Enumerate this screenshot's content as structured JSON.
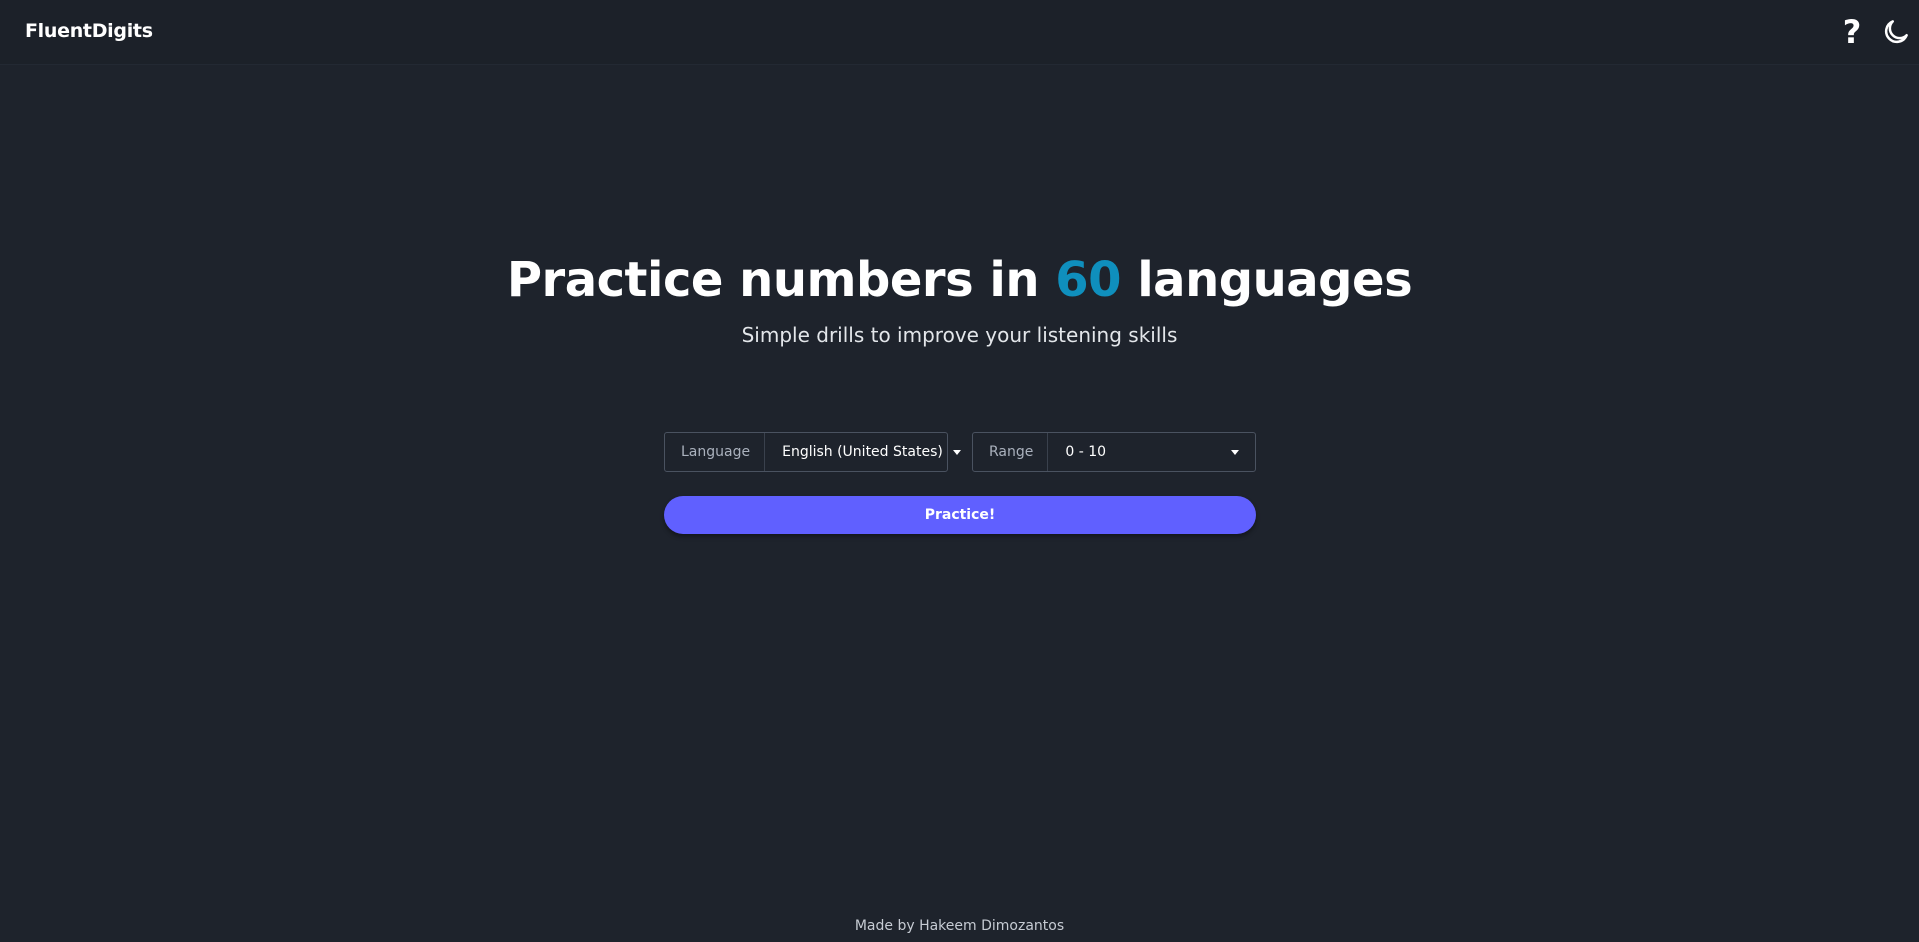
{
  "header": {
    "brand": "FluentDigits",
    "help_icon": "question-mark-icon",
    "theme_icon": "moon-icon"
  },
  "hero": {
    "title_before": "Practice numbers in ",
    "title_count": "60",
    "title_after": " languages",
    "subtitle": "Simple drills to improve your listening skills"
  },
  "controls": {
    "language_label": "Language",
    "language_value": "English (United States)",
    "range_label": "Range",
    "range_value": "0 - 10",
    "practice_label": "Practice!"
  },
  "footer": {
    "credit": "Made by Hakeem Dimozantos"
  },
  "colors": {
    "background": "#1e232c",
    "accent": "#0f8fbd",
    "button": "#6060ff"
  }
}
